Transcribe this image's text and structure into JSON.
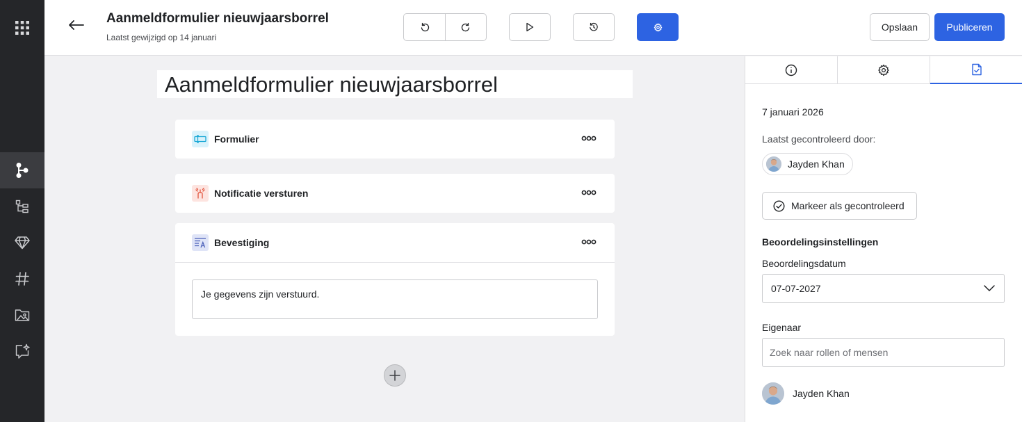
{
  "header": {
    "title": "Aanmeldformulier nieuwjaarsborrel",
    "subtitle": "Laatst gewijzigd op 14 januari",
    "save_label": "Opslaan",
    "publish_label": "Publiceren"
  },
  "canvas": {
    "form_title": "Aanmeldformulier nieuwjaarsborrel",
    "cards": [
      {
        "label": "Formulier"
      },
      {
        "label": "Notificatie versturen"
      },
      {
        "label": "Bevestiging",
        "message": "Je gegevens zijn verstuurd."
      }
    ]
  },
  "panel": {
    "date": "7 januari 2026",
    "last_checked_label": "Laatst gecontroleerd door:",
    "checked_by": "Jayden Khan",
    "mark_button": "Markeer als gecontroleerd",
    "review_settings_title": "Beoordelingsinstellingen",
    "review_date_label": "Beoordelingsdatum",
    "review_date_value": "07-07-2027",
    "owner_label": "Eigenaar",
    "owner_search_placeholder": "Zoek naar rollen of mensen",
    "owner_name": "Jayden Khan"
  },
  "colors": {
    "accent": "#2d63e2",
    "rail": "#252629",
    "canvas_bg": "#f1f1f3"
  }
}
